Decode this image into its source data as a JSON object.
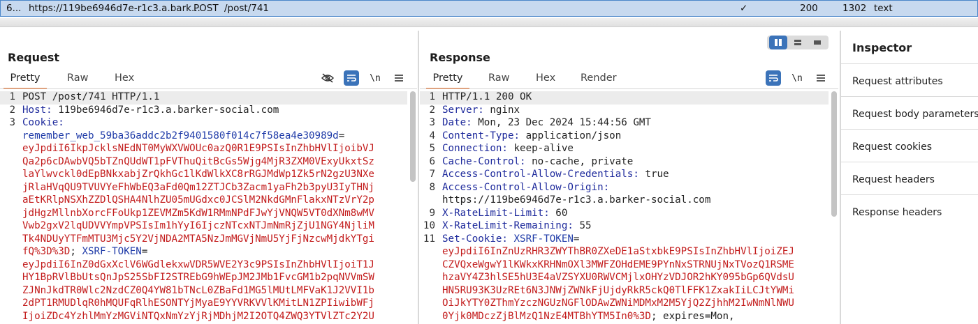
{
  "history_row": {
    "index": "6...",
    "host": "https://119be6946d7e-r1c3.a.bark...",
    "method": "POST",
    "path": "/post/741",
    "check": "✓",
    "status": "200",
    "length": "1302",
    "mime": "text"
  },
  "request": {
    "title": "Request",
    "tabs": [
      "Pretty",
      "Raw",
      "Hex"
    ],
    "active_tab": "Pretty",
    "newline_toggle": "\\n",
    "lines": [
      {
        "n": "1",
        "segments": [
          {
            "t": "POST /post/741 HTTP/1.1",
            "c": "plain"
          }
        ]
      },
      {
        "n": "2",
        "segments": [
          {
            "t": "Host: ",
            "c": "hn"
          },
          {
            "t": "119be6946d7e-r1c3.a.barker-social.com",
            "c": "plain"
          }
        ]
      },
      {
        "n": "3",
        "segments": [
          {
            "t": "Cookie:",
            "c": "hn"
          }
        ]
      },
      {
        "n": "",
        "segments": [
          {
            "t": "remember_web_59ba36addc2b2f9401580f014c7f58ea4e30989d",
            "c": "blu"
          },
          {
            "t": "=",
            "c": "plain"
          }
        ]
      },
      {
        "n": "",
        "segments": [
          {
            "t": "eyJpdiI6IkpJcklsNEdNT0MyWXVWOUc0azQ0R1E9PSIsInZhbHVlIjoibVJ",
            "c": "red"
          }
        ]
      },
      {
        "n": "",
        "segments": [
          {
            "t": "Qa2p6cDAwbVQ5bTZnQUdWT1pFVThuQitBcGs5Wjg4MjR3ZXM0VExyUkxtSz",
            "c": "red"
          }
        ]
      },
      {
        "n": "",
        "segments": [
          {
            "t": "laYlwvckl0dEpBNkxabjZrQkhGc1lKdWlkXC8rRGJMdWp1Zk5rN2gzU3NXe",
            "c": "red"
          }
        ]
      },
      {
        "n": "",
        "segments": [
          {
            "t": "jRlaHVqQU9TVUVYeFhWbEQ3aFd0Qm12ZTJCb3Zacm1yaFh2b3pyU3IyTHNj",
            "c": "red"
          }
        ]
      },
      {
        "n": "",
        "segments": [
          {
            "t": "aEtKRlpNSXhZZDlQSHA4NlhZU05mUGdxc0JCSlM2NkdGMnFlakxNTzVrY2p",
            "c": "red"
          }
        ]
      },
      {
        "n": "",
        "segments": [
          {
            "t": "jdHgzMllnbXorcFFoUkp1ZEVMZm5KdW1RMmNPdFJwYjVNQW5VT0dXNm8wMV",
            "c": "red"
          }
        ]
      },
      {
        "n": "",
        "segments": [
          {
            "t": "Vwb2gxV2lqUDVVYmpVPSIsIm1hYyI6IjczNTcxNTJmNmRjZjU1NGY4NjliM",
            "c": "red"
          }
        ]
      },
      {
        "n": "",
        "segments": [
          {
            "t": "Tk4NDUyYTFmMTU3Mjc5Y2VjNDA2MTA5NzJmMGVjNmU5YjFjNzcwMjdkYTgi",
            "c": "red"
          }
        ]
      },
      {
        "n": "",
        "segments": [
          {
            "t": "fQ%3D%3D",
            "c": "red"
          },
          {
            "t": "; ",
            "c": "plain"
          },
          {
            "t": "XSRF-TOKEN",
            "c": "blu"
          },
          {
            "t": "=",
            "c": "plain"
          }
        ]
      },
      {
        "n": "",
        "segments": [
          {
            "t": "eyJpdiI6InZ0dGxXclV6WGdlekxwVDR5WVE2Y3c9PSIsInZhbHVlIjoiT1J",
            "c": "red"
          }
        ]
      },
      {
        "n": "",
        "segments": [
          {
            "t": "HY1BpRVlBbUtsQnJpS25SbFI2STREbG9hWEpJM2JMb1FvcGM1b2pqNVVmSW",
            "c": "red"
          }
        ]
      },
      {
        "n": "",
        "segments": [
          {
            "t": "ZJNnJkdTR0Wlc2NzdCZ0Q4YW81bTNcL0ZBaFd1MG5lMUtLMFVaK1J2VVI1b",
            "c": "red"
          }
        ]
      },
      {
        "n": "",
        "segments": [
          {
            "t": "2dPT1RMUDlqR0hMQUFqRlhESONTYjMyaE9YYVRKVVlKMitLN1ZPIiwibWFj",
            "c": "red"
          }
        ]
      },
      {
        "n": "",
        "segments": [
          {
            "t": "IjoiZDc4YzhlMmYzMGViNTQxNmYzYjRjMDhjM2I2OTQ4ZWQ3YTVlZTc2Y2U",
            "c": "red"
          }
        ]
      }
    ]
  },
  "response": {
    "title": "Response",
    "tabs": [
      "Pretty",
      "Raw",
      "Hex",
      "Render"
    ],
    "active_tab": "Pretty",
    "newline_toggle": "\\n",
    "lines": [
      {
        "n": "1",
        "segments": [
          {
            "t": "HTTP/1.1 200 OK",
            "c": "plain"
          }
        ]
      },
      {
        "n": "2",
        "segments": [
          {
            "t": "Server: ",
            "c": "hn"
          },
          {
            "t": "nginx",
            "c": "plain"
          }
        ]
      },
      {
        "n": "3",
        "segments": [
          {
            "t": "Date: ",
            "c": "hn"
          },
          {
            "t": "Mon, 23 Dec 2024 15:44:56 GMT",
            "c": "plain"
          }
        ]
      },
      {
        "n": "4",
        "segments": [
          {
            "t": "Content-Type: ",
            "c": "hn"
          },
          {
            "t": "application/json",
            "c": "plain"
          }
        ]
      },
      {
        "n": "5",
        "segments": [
          {
            "t": "Connection: ",
            "c": "hn"
          },
          {
            "t": "keep-alive",
            "c": "plain"
          }
        ]
      },
      {
        "n": "6",
        "segments": [
          {
            "t": "Cache-Control: ",
            "c": "hn"
          },
          {
            "t": "no-cache, private",
            "c": "plain"
          }
        ]
      },
      {
        "n": "7",
        "segments": [
          {
            "t": "Access-Control-Allow-Credentials: ",
            "c": "hn"
          },
          {
            "t": "true",
            "c": "plain"
          }
        ]
      },
      {
        "n": "8",
        "segments": [
          {
            "t": "Access-Control-Allow-Origin:",
            "c": "hn"
          }
        ]
      },
      {
        "n": "",
        "segments": [
          {
            "t": "https://119be6946d7e-r1c3.a.barker-social.com",
            "c": "plain"
          }
        ]
      },
      {
        "n": "9",
        "segments": [
          {
            "t": "X-RateLimit-Limit: ",
            "c": "hn"
          },
          {
            "t": "60",
            "c": "plain"
          }
        ]
      },
      {
        "n": "10",
        "segments": [
          {
            "t": "X-RateLimit-Remaining: ",
            "c": "hn"
          },
          {
            "t": "55",
            "c": "plain"
          }
        ]
      },
      {
        "n": "11",
        "segments": [
          {
            "t": "Set-Cookie: ",
            "c": "hn"
          },
          {
            "t": "XSRF-TOKEN",
            "c": "blu"
          },
          {
            "t": "=",
            "c": "plain"
          }
        ]
      },
      {
        "n": "",
        "segments": [
          {
            "t": "eyJpdiI6InZnUzRHR3ZWYThBR0ZXeDE1aStxbkE9PSIsInZhbHVlIjoiZEJ",
            "c": "red"
          }
        ]
      },
      {
        "n": "",
        "segments": [
          {
            "t": "CZVQxeWgwY1lKWkxKRHNmOXl3MWFZOHdEME9PYnNxSTRNUjNxTVozQ1RSME",
            "c": "red"
          }
        ]
      },
      {
        "n": "",
        "segments": [
          {
            "t": "hzaVY4Z3hlSE5hU3E4aVZSYXU0RWVCMjlxOHYzVDJOR2hKY095bGp6QVdsU",
            "c": "red"
          }
        ]
      },
      {
        "n": "",
        "segments": [
          {
            "t": "HN5RU93K3UzREt6N3JNWjZWNkFjUjdyRkR5ckQ0TlFFK1ZxakIiLCJtYWMi",
            "c": "red"
          }
        ]
      },
      {
        "n": "",
        "segments": [
          {
            "t": "OiJkYTY0ZThmYzczNGUzNGFlODAwZWNiMDMxM2M5YjQ2ZjhhM2IwNmNlNWU",
            "c": "red"
          }
        ]
      },
      {
        "n": "",
        "segments": [
          {
            "t": "0Yjk0MDczZjBlMzQ1NzE4MTBhYTM5In0%3D",
            "c": "red"
          },
          {
            "t": "; expires=Mon,",
            "c": "plain"
          }
        ]
      }
    ]
  },
  "inspector": {
    "title": "Inspector",
    "items": [
      "Request attributes",
      "Request body parameters",
      "Request cookies",
      "Request headers",
      "Response headers"
    ]
  },
  "colors": {
    "header_name": "#1e2a9c",
    "token_value": "#c31d1d",
    "cookie_name": "#1f3ba8",
    "accent_tab": "#e8702a",
    "button_blue": "#3b73b9",
    "history_row_bg": "#c7d9ef"
  }
}
